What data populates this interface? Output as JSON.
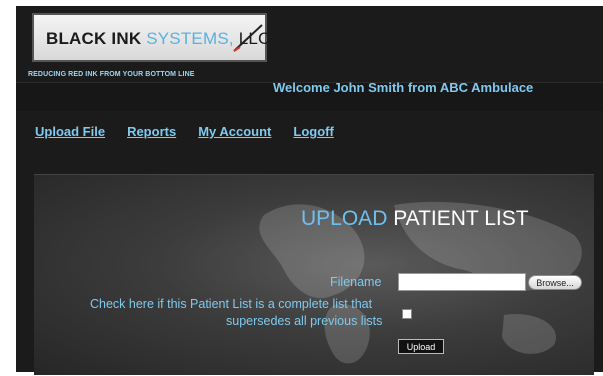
{
  "brand": {
    "logo_main": "BLACK INK ",
    "logo_systems": "SYSTEMS,",
    "logo_llc": " LLC",
    "tagline": "REDUCING RED INK FROM YOUR BOTTOM LINE"
  },
  "header": {
    "welcome": "Welcome John Smith from ABC Ambulace"
  },
  "nav": {
    "items": [
      {
        "label": "Upload File"
      },
      {
        "label": "Reports"
      },
      {
        "label": "My Account"
      },
      {
        "label": "Logoff"
      }
    ]
  },
  "main": {
    "title_part1": "UPLOAD",
    "title_part2": " PATIENT LIST",
    "filename_label": "Filename",
    "browse_label": "Browse...",
    "checkbox_label_line1": "Check here if this Patient List is a complete list that",
    "checkbox_label_line2": "supersedes all previous lists",
    "upload_label": "Upload"
  },
  "colors": {
    "accent": "#7fcaf0",
    "background": "#1b1b1b"
  }
}
